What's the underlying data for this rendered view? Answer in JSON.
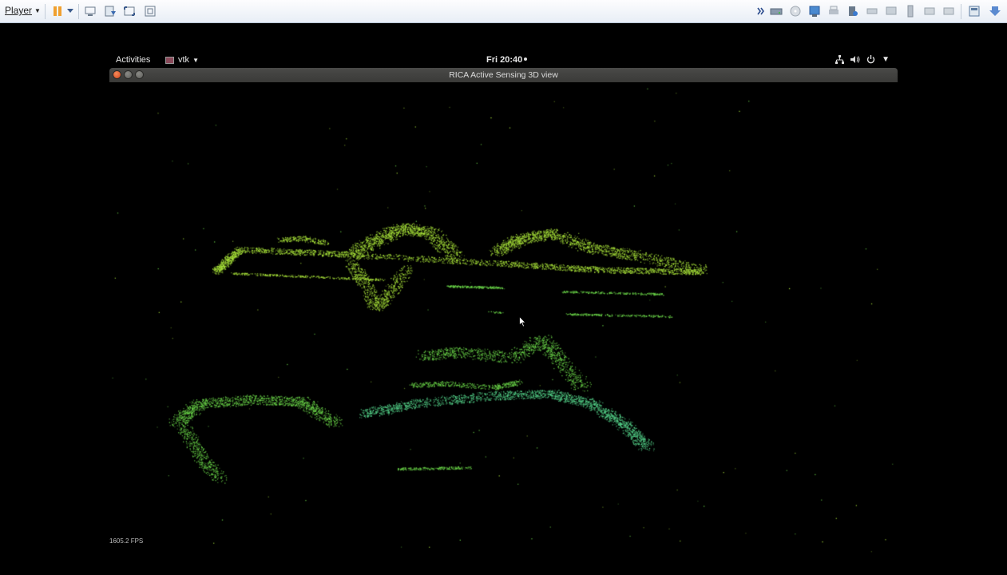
{
  "vm_toolbar": {
    "player_label": "Player",
    "left_icons": [
      "pause-icon",
      "dropdown-arrow-icon",
      "send-ctrl-alt-del-icon",
      "snapshot-icon",
      "fullscreen-icon",
      "unity-icon"
    ],
    "right_icons": [
      "expand-arrows-icon",
      "hard-disk-icon",
      "cd-drive-icon",
      "network-adapter-icon",
      "printer-icon",
      "sound-card-icon",
      "usb-device-icon",
      "display-icon",
      "usb-stick-icon",
      "message-icon",
      "message-icon-2",
      "vm-settings-icon",
      "download-icon"
    ]
  },
  "gnome_top_bar": {
    "activities": "Activities",
    "app_menu": "vtk",
    "clock": "Fri 20:40",
    "tray_icons": [
      "network-wired-icon",
      "volume-icon",
      "power-icon"
    ]
  },
  "window": {
    "title": "RICA Active Sensing 3D view",
    "fps": "1605.2 FPS"
  },
  "colors": {
    "points_yellow_green": "#a8e23a",
    "points_green": "#6cd84a",
    "points_teal": "#56d68c",
    "background": "#000000"
  }
}
